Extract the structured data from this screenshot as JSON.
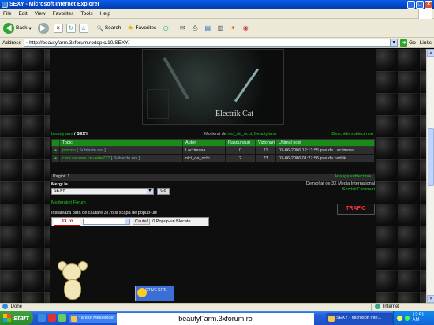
{
  "window": {
    "title": "SEXY - Microsoft Internet Explorer",
    "controls": [
      "_",
      "□",
      "×"
    ]
  },
  "menu": [
    "File",
    "Edit",
    "View",
    "Favorites",
    "Tools",
    "Help"
  ],
  "toolbar": {
    "back": "Back",
    "search": "Search",
    "favorites": "Favorites"
  },
  "address": {
    "label": "Address",
    "url": "http://beautyfarm.3xforum.ro/topic/10/SEXY/",
    "go": "Go",
    "links": "Links"
  },
  "forum": {
    "banner_text": "Electrik Cat",
    "breadcrumb_forum": "beautyfarm",
    "breadcrumb_sep": " / ",
    "breadcrumb_topic": "SEXY",
    "moderated_label": "Moderat de",
    "moderators": "nici_de_ochi, Beautyfarm",
    "new_topic": "Deschide subiect nou",
    "columns": [
      "",
      "Topic",
      "Autor",
      "Raspunsuri",
      "Vizionari",
      "Ultimul post"
    ],
    "rows": [
      {
        "bullet": "●",
        "title": "pomno",
        "pages": "[ Subiecte noi ]",
        "author": "Lacrimosa",
        "replies": "0",
        "views": "21",
        "last": "03-06-2006 12:13:55 pus de Lacrimosa"
      },
      {
        "bullet": "●",
        "title": "care ce vrea ce vede???",
        "pages": "[ Subiecte noi ]",
        "author": "nici_de_ochi",
        "replies": "2",
        "views": "73",
        "last": "03-06-2006 01:27:56 pus de cedrik"
      }
    ],
    "pages_label": "Pagini:",
    "pages_value": "1",
    "add_topic": "Adauga subiect nou",
    "jump_label": "Mergi la",
    "jump_value": "SEXY",
    "jump_btn": "Go",
    "powered_line1": "Dezvoltat de 3X Media International",
    "powered_line2": "Servicii Forumuri",
    "moderators_link": "Moderatori Forum",
    "install_text": "Instaleaza bara de cautare 3x.ro si scapa de popup-uri!",
    "search_logo": "3X.ro",
    "search_btn": "Cauta!",
    "popup_blocked": "0 Popup-uri Blocate",
    "trafic_logo": "TRAFIC",
    "badge_text": "ACTIVE SITE"
  },
  "status": {
    "left": "Done",
    "zone": "Internet"
  },
  "taskbar": {
    "start": "start",
    "tasks": [
      "Yahoo! Messenger",
      "SEXY - Microsoft Inte..."
    ],
    "time": "12:51 AM"
  },
  "caption": "beautyFarm.3xforum.ro"
}
